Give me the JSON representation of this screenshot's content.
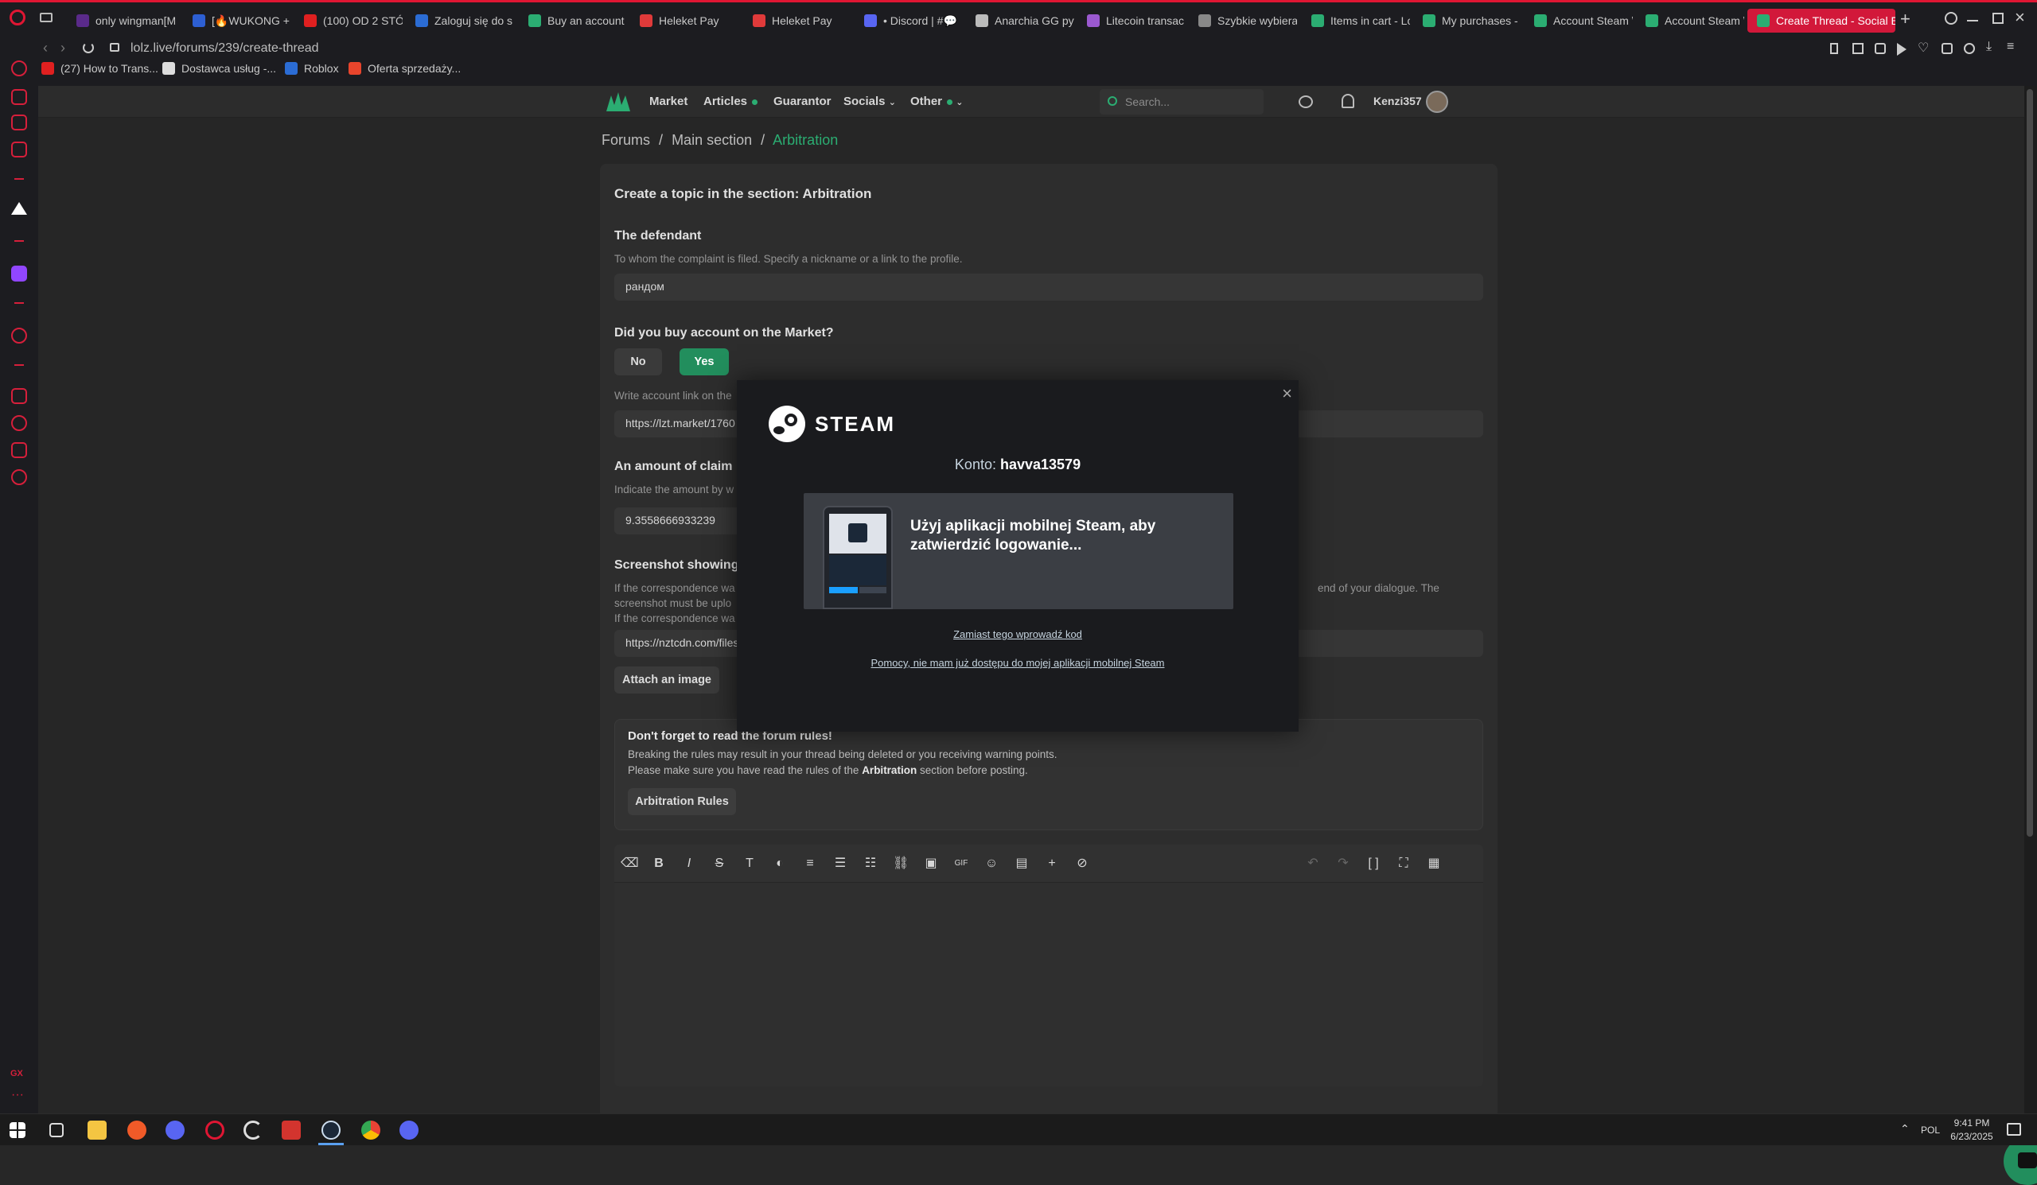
{
  "browser": {
    "tabs": [
      {
        "label": "only wingman[M",
        "color": "#5a2a8a"
      },
      {
        "label": "[🔥WUKONG + F",
        "color": "#2d5fd3"
      },
      {
        "label": "(100) OD 2 STÓ",
        "color": "#e02020"
      },
      {
        "label": "Zaloguj się do s",
        "color": "#2b6cd4"
      },
      {
        "label": "Buy an account",
        "color": "#2bad72"
      },
      {
        "label": "Heleket Pay",
        "color": "#e03a3a"
      },
      {
        "label": "Heleket Pay",
        "color": "#e03a3a"
      },
      {
        "label": "• Discord | #💬",
        "color": "#5865f2"
      },
      {
        "label": "Anarchia GG pyt",
        "color": "#bbbbbb"
      },
      {
        "label": "Litecoin transac",
        "color": "#9b59d0"
      },
      {
        "label": "Szybkie wybiera",
        "color": "#888888"
      },
      {
        "label": "Items in cart - Lo",
        "color": "#2bad72"
      },
      {
        "label": "My purchases -",
        "color": "#2bad72"
      },
      {
        "label": "Account Steam \\",
        "color": "#2bad72"
      },
      {
        "label": "Account Steam \\",
        "color": "#2bad72"
      },
      {
        "label": "Create Thread - Social En",
        "color": "#2bad72"
      }
    ],
    "url": "lolz.live/forums/239/create-thread",
    "bookmarks": [
      {
        "label": "(27) How to Trans...",
        "color": "#e02020"
      },
      {
        "label": "Dostawca usług -...",
        "color": "#dddddd"
      },
      {
        "label": "Roblox",
        "color": "#2b6cd4"
      },
      {
        "label": "Oferta sprzedaży...",
        "color": "#e8452c"
      }
    ],
    "accent": "#e01633"
  },
  "site": {
    "accent": "#2bad72",
    "nav": {
      "market": "Market",
      "articles": "Articles",
      "guarantor": "Guarantor",
      "socials": "Socials",
      "other": "Other"
    },
    "search_placeholder": "Search...",
    "username": "Kenzi357",
    "breadcrumb": {
      "forums": "Forums",
      "sep": "/",
      "main": "Main section",
      "current": "Arbitration"
    }
  },
  "form": {
    "title": "Create a topic in the section: Arbitration",
    "defendant": {
      "label": "The defendant",
      "hint": "To whom the complaint is filed. Specify a nickname or a link to the profile.",
      "value": "рандом"
    },
    "market_question": {
      "label": "Did you buy account on the Market?",
      "no": "No",
      "yes": "Yes"
    },
    "account_link": {
      "hint": "Write account link on the",
      "value": "https://lzt.market/1760"
    },
    "claim": {
      "label": "An amount of claim",
      "hint": "Indicate the amount by w",
      "value": "9.3558666933239"
    },
    "screenshot": {
      "label": "Screenshot showing t",
      "hint1": "If the correspondence wa",
      "hint1_right": "end of your dialogue. The",
      "hint2": "screenshot must be uplo",
      "hint3": "If the correspondence wa",
      "value": "https://nztcdn.com/files",
      "attach_button": "Attach an image"
    },
    "rules": {
      "heading": "Don't forget to read the forum rules!",
      "line1": "Breaking the rules may result in your thread being deleted or you receiving warning points.",
      "line2_pre": "Please make sure you have read the rules of the",
      "line2_bold": "Arbitration",
      "line2_post": "section before posting.",
      "button": "Arbitration Rules"
    }
  },
  "steam_modal": {
    "brand": "STEAM",
    "account_label": "Konto:",
    "account_name": "havva13579",
    "message": "Użyj aplikacji mobilnej Steam, aby zatwierdzić logowanie...",
    "link_code": "Zamiast tego wprowadź kod",
    "link_help": "Pomocy, nie mam już dostępu do mojej aplikacji mobilnej Steam",
    "close": "×"
  },
  "taskbar": {
    "lang": "POL",
    "time": "9:41 PM",
    "date": "6/23/2025"
  }
}
